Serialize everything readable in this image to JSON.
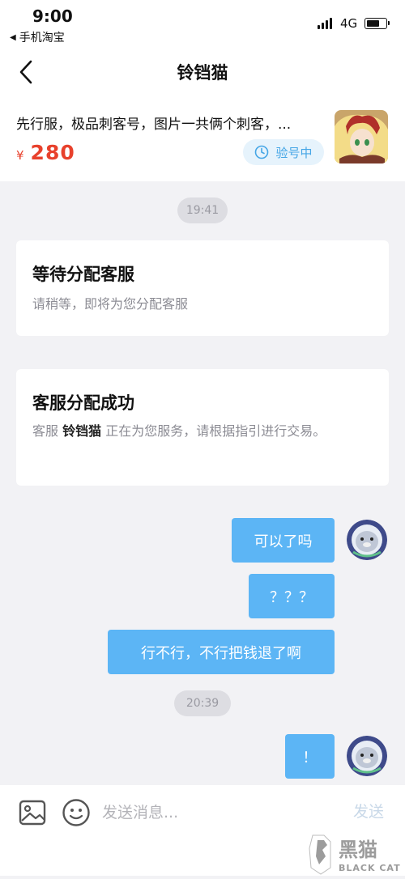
{
  "status_bar": {
    "time": "9:00",
    "back_app": "手机淘宝",
    "back_arrow": "◀",
    "network": "4G",
    "battery_level": 0.7
  },
  "nav": {
    "title": "铃铛猫"
  },
  "product": {
    "description": "先行服，极品刺客号，图片一共俩个刺客，...",
    "price_symbol": "¥",
    "price": "280",
    "badge": "验号中"
  },
  "chat": {
    "time1": "19:41",
    "system1": {
      "title": "等待分配客服",
      "text": "请稍等，即将为您分配客服"
    },
    "system2": {
      "title": "客服分配成功",
      "text_before": "客服",
      "agent_name": "铃铛猫",
      "text_after": "正在为您服务，请根据指引进行交易。"
    },
    "messages_group1": [
      "可以了吗",
      "？？？",
      "行不行，不行把钱退了啊"
    ],
    "time2": "20:39",
    "messages_group2": [
      "！"
    ]
  },
  "input": {
    "placeholder": "发送消息...",
    "send_label": "发送"
  },
  "watermark": {
    "cn": "黑猫",
    "en": "BLACK CAT"
  },
  "colors": {
    "accent_price": "#e8412c",
    "bubble": "#5cb5f5",
    "badge_bg": "#e6f3fc",
    "badge_text": "#45a6e6",
    "page_bg": "#f2f2f5"
  }
}
